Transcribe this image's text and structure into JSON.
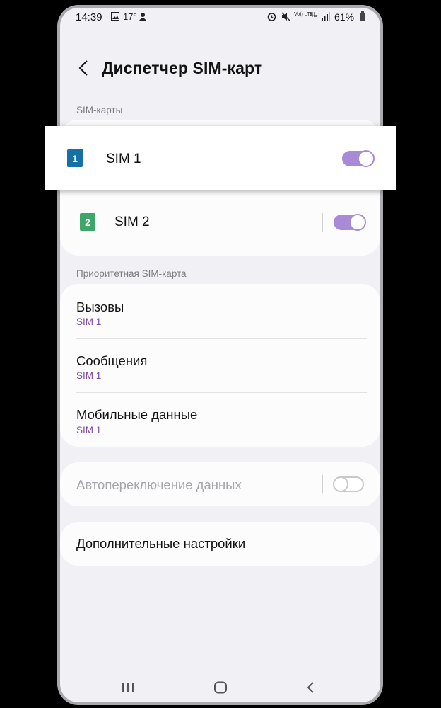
{
  "status_bar": {
    "time": "14:39",
    "icons": [
      "gallery-icon",
      "temperature-icon",
      "notification-icon"
    ],
    "temperature": "17°",
    "right_icons": [
      "alarm-icon",
      "mute-icon",
      "volte-icon",
      "4g-icon",
      "signal-icon"
    ],
    "volte_label": "Vo)) LTE1",
    "network_label": "4G",
    "battery": "61%"
  },
  "header": {
    "title": "Диспетчер SIM-карт"
  },
  "sections": {
    "sim_cards_label": "SIM-карты",
    "priority_label": "Приоритетная SIM-карта"
  },
  "sims": [
    {
      "badge": "1",
      "name": "SIM 1",
      "color": "#1570a6",
      "enabled": true
    },
    {
      "badge": "2",
      "name": "SIM 2",
      "color": "#3fa66a",
      "enabled": true
    }
  ],
  "priority": [
    {
      "title": "Вызовы",
      "value": "SIM 1"
    },
    {
      "title": "Сообщения",
      "value": "SIM 1"
    },
    {
      "title": "Мобильные данные",
      "value": "SIM 1"
    }
  ],
  "auto_switch": {
    "label": "Автопереключение данных",
    "enabled": false
  },
  "more_settings": {
    "label": "Дополнительные настройки"
  },
  "colors": {
    "accent": "#a98ad6",
    "sub_text": "#7d4aa8",
    "background": "#f1f0f5"
  }
}
